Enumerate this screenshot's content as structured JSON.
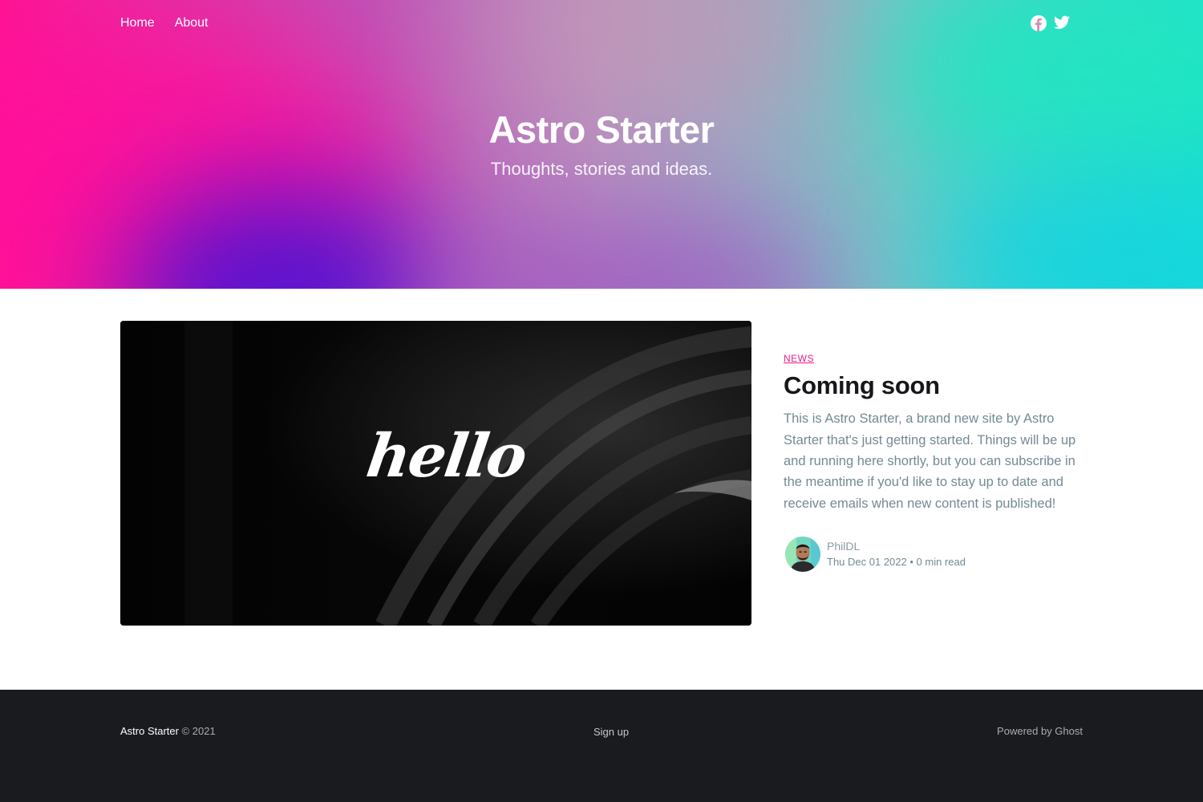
{
  "nav": {
    "links": [
      {
        "label": "Home"
      },
      {
        "label": "About"
      }
    ],
    "social": [
      "facebook-icon",
      "twitter-icon"
    ]
  },
  "site": {
    "title": "Astro Starter",
    "description": "Thoughts, stories and ideas."
  },
  "post": {
    "image_text": "hello",
    "tag": "News",
    "title": "Coming soon",
    "excerpt": "This is Astro Starter, a brand new site by Astro Starter that's just getting started. Things will be up and running here shortly, but you can subscribe in the meantime if you'd like to stay up to date and receive emails when new content is published!",
    "author": "PhilDL",
    "date": "Thu Dec 01 2022",
    "separator": "•",
    "reading_time": "0 min read"
  },
  "footer": {
    "brand": "Astro Starter",
    "copyright": "© 2021",
    "signup": "Sign up",
    "powered": "Powered by Ghost"
  },
  "colors": {
    "accent": "#e81e8c",
    "footer_bg": "#191b1f",
    "text_muted": "#738a94"
  }
}
